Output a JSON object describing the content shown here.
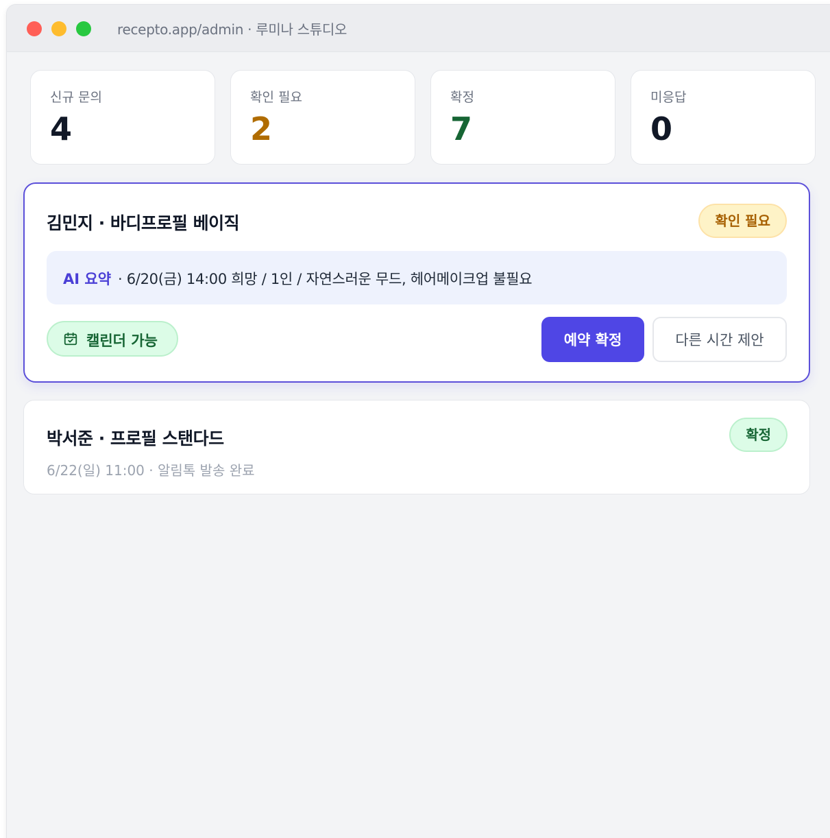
{
  "window": {
    "url": "recepto.app/admin · 루미나 스튜디오"
  },
  "stats": [
    {
      "label": "신규 문의",
      "value": "4",
      "color": "#111827"
    },
    {
      "label": "확인 필요",
      "value": "2",
      "color": "#b06c00"
    },
    {
      "label": "확정",
      "value": "7",
      "color": "#166534"
    },
    {
      "label": "미응답",
      "value": "0",
      "color": "#111827"
    }
  ],
  "inquiry_active": {
    "title": "김민지 · 바디프로필 베이직",
    "status": "확인 필요",
    "ai_label": "AI 요약",
    "summary": "· 6/20(금) 14:00 희망 / 1인 / 자연스러운 무드, 헤어메이크업 불필요",
    "calendar_chip": "캘린더 가능",
    "calendar_icon": "calendar-check-icon",
    "confirm_button": "예약 확정",
    "suggest_button": "다른 시간 제안",
    "accent": "#4f46e5"
  },
  "inquiry_confirmed": {
    "title": "박서준 · 프로필 스탠다드",
    "status": "확정",
    "meta": "6/22(일) 11:00 · 알림톡 발송 완료"
  }
}
